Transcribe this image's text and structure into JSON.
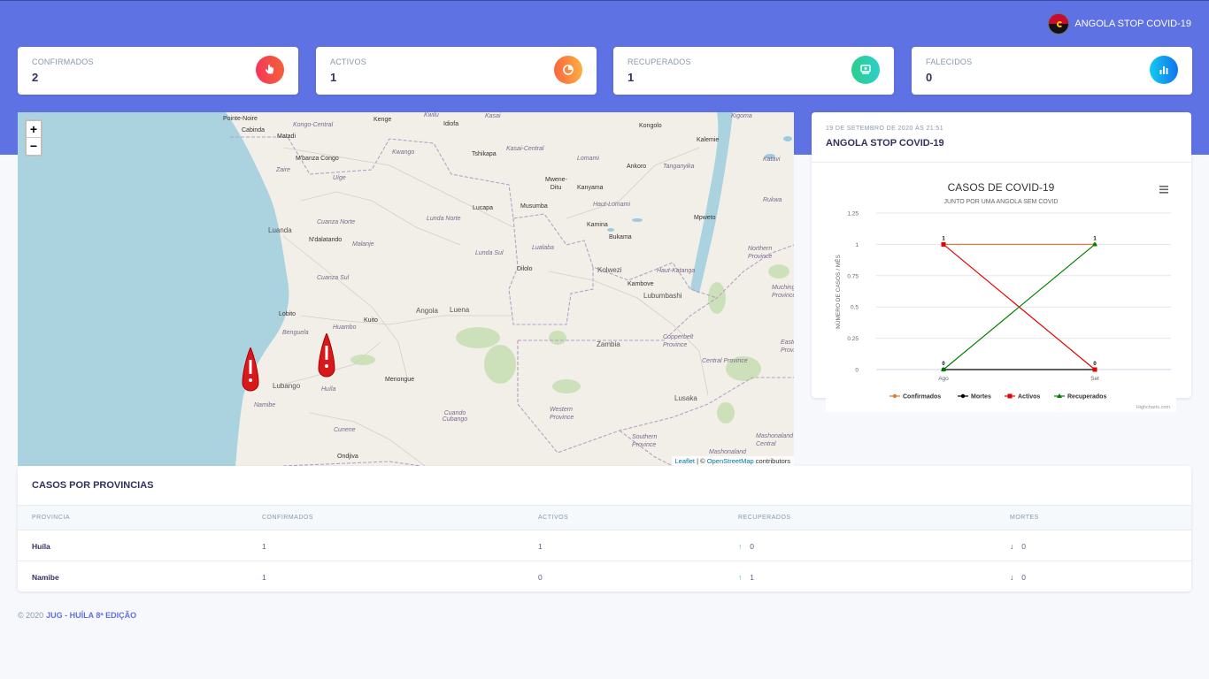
{
  "header": {
    "brand": "ANGOLA STOP COVID-19"
  },
  "stats": [
    {
      "title": "CONFIRMADOS",
      "value": "2",
      "color": "#f5365c",
      "icon": "pointer-hand-icon"
    },
    {
      "title": "ACTIVOS",
      "value": "1",
      "color": "#fb6340",
      "icon": "pie-chart-icon"
    },
    {
      "title": "RECUPERADOS",
      "value": "1",
      "color": "#2dce89",
      "icon": "money-coins-icon"
    },
    {
      "title": "FALECIDOS",
      "value": "0",
      "color": "#11cdef",
      "icon": "bar-chart-icon"
    }
  ],
  "map": {
    "zoom_in": "+",
    "zoom_out": "−",
    "attribution": {
      "leaflet": "Leaflet",
      "sep": " | © ",
      "osm": "OpenStreetMap",
      "suffix": " contributors"
    },
    "labels": [
      "Pointe-Noire",
      "Cabinda",
      "Matadi",
      "M'banza Congo",
      "Zaire",
      "Uíge",
      "Luanda",
      "N'dalatando",
      "Cuanza Norte",
      "Malanje",
      "Cuanza Sul",
      "Lobito",
      "Benguela",
      "Huambo",
      "Kuito",
      "Angola",
      "Luena",
      "Lubango",
      "Huíla",
      "Namibe",
      "Menongue",
      "Cuando Cubango",
      "Cunene",
      "Ondjiva",
      "Kenge",
      "Kwilu",
      "Idiofa",
      "Kasai",
      "Kongo-Central",
      "Tshikapa",
      "Kasai-Central",
      "Kwango",
      "Lomami",
      "Kongolo",
      "Kalemie",
      "Kigoma",
      "Mwene-Ditu",
      "Kanyama",
      "Ankoro",
      "Tanganyika",
      "Katavi",
      "Lualaba",
      "Lunda Norte",
      "Lucapa",
      "Musumba",
      "Kamina",
      "Bukama",
      "Lunda Sul",
      "Haut-Lomami",
      "Dilolo",
      "Kolwezi",
      "Kambove",
      "Haut-Katanga",
      "Lubumbashi",
      "Mpweto",
      "Rukwa",
      "Northern Province",
      "Muchinga Province",
      "Zambia",
      "Copperbelt Province",
      "Central Province",
      "Eastern Province",
      "Lusaka",
      "Western Province",
      "Southern Province",
      "Mashonaland Central",
      "Mashonaland"
    ]
  },
  "chart_card": {
    "date": "19 DE SETEMBRO DE 2020 ÀS 21:51",
    "title": "ANGOLA STOP COVID-19"
  },
  "chart_data": {
    "type": "line",
    "title": "CASOS DE COVID-19",
    "subtitle": "JUNTO POR UMA ANGOLA SEM COVID",
    "xlabel": "",
    "ylabel": "NÚMERO DE CASOS / MÊS",
    "categories": [
      "Ago",
      "Set"
    ],
    "ylim": [
      0,
      1.25
    ],
    "yticks": [
      "0",
      "0.25",
      "0.5",
      "0.75",
      "1",
      "1.25"
    ],
    "grid": true,
    "legend_position": "bottom",
    "credits": "Highcharts.com",
    "series": [
      {
        "name": "Confirmados",
        "values": [
          1,
          1
        ],
        "color": "#e07b39"
      },
      {
        "name": "Mortes",
        "values": [
          0,
          0
        ],
        "color": "#000000"
      },
      {
        "name": "Activos",
        "values": [
          1,
          0
        ],
        "color": "#e60000"
      },
      {
        "name": "Recuperados",
        "values": [
          0,
          1
        ],
        "color": "#008000"
      }
    ],
    "data_labels": [
      {
        "category": "Ago",
        "value": 1,
        "text": "1"
      },
      {
        "category": "Set",
        "value": 1,
        "text": "1"
      },
      {
        "category": "Ago",
        "value": 0,
        "text": "0"
      },
      {
        "category": "Set",
        "value": 0,
        "text": "0"
      }
    ]
  },
  "table": {
    "title": "CASOS POR PROVINCIAS",
    "columns": [
      "PROVINCIA",
      "CONFIRMADOS",
      "ACTIVOS",
      "RECUPERADOS",
      "MORTES"
    ],
    "rows": [
      {
        "provincia": "Huíla",
        "confirmados": "1",
        "activos": "1",
        "recuperados": "0",
        "mortes": "0"
      },
      {
        "provincia": "Namibe",
        "confirmados": "1",
        "activos": "0",
        "recuperados": "1",
        "mortes": "0"
      }
    ]
  },
  "footer": {
    "copyright": "© 2020",
    "link": "JUG - HUÍLA 8ª EDIÇÃO"
  }
}
